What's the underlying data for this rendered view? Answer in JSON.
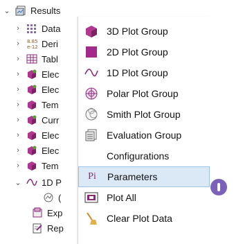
{
  "tree": {
    "root": {
      "label": "Results",
      "icon": "results-icon"
    },
    "items": [
      {
        "label": "Data",
        "icon": "datasets-icon"
      },
      {
        "label": "Deri",
        "icon": "derived-values-icon"
      },
      {
        "label": "Tabl",
        "icon": "tables-icon"
      },
      {
        "label": "Elec",
        "icon": "plot-group-3d-icon"
      },
      {
        "label": "Elec",
        "icon": "plot-group-3d-icon"
      },
      {
        "label": "Tem",
        "icon": "plot-group-3d-icon"
      },
      {
        "label": "Curr",
        "icon": "plot-group-3d-icon"
      },
      {
        "label": "Elec",
        "icon": "plot-group-3d-icon"
      },
      {
        "label": "Elec",
        "icon": "plot-group-3d-icon"
      },
      {
        "label": "Tem",
        "icon": "plot-group-3d-icon"
      },
      {
        "label": "1D P",
        "icon": "plot-group-1d-icon"
      }
    ],
    "child_items": [
      {
        "label": "(",
        "icon": "global-plot-icon"
      },
      {
        "label": "Exp",
        "icon": "export-icon"
      },
      {
        "label": "Rep",
        "icon": "report-icon"
      }
    ]
  },
  "menu": {
    "items": [
      {
        "label": "3D Plot Group",
        "icon": "plot-group-3d-icon"
      },
      {
        "label": "2D Plot Group",
        "icon": "plot-group-2d-icon"
      },
      {
        "label": "1D Plot Group",
        "icon": "plot-group-1d-icon"
      },
      {
        "label": "Polar Plot Group",
        "icon": "polar-plot-icon"
      },
      {
        "label": "Smith Plot Group",
        "icon": "smith-plot-icon"
      },
      {
        "label": "Evaluation Group",
        "icon": "evaluation-group-icon"
      },
      {
        "label": "Configurations",
        "icon": ""
      },
      {
        "label": "Parameters",
        "icon": "parameters-icon",
        "highlighted": true
      },
      {
        "label": "Plot All",
        "icon": "plot-all-icon"
      },
      {
        "label": "Clear Plot Data",
        "icon": "clear-plot-data-icon"
      }
    ],
    "parameters_icon_text": "Pi"
  },
  "colors": {
    "folder_purple": "#a12a8b",
    "highlight": "#dbe9f7",
    "badge": "#7b62b8"
  }
}
